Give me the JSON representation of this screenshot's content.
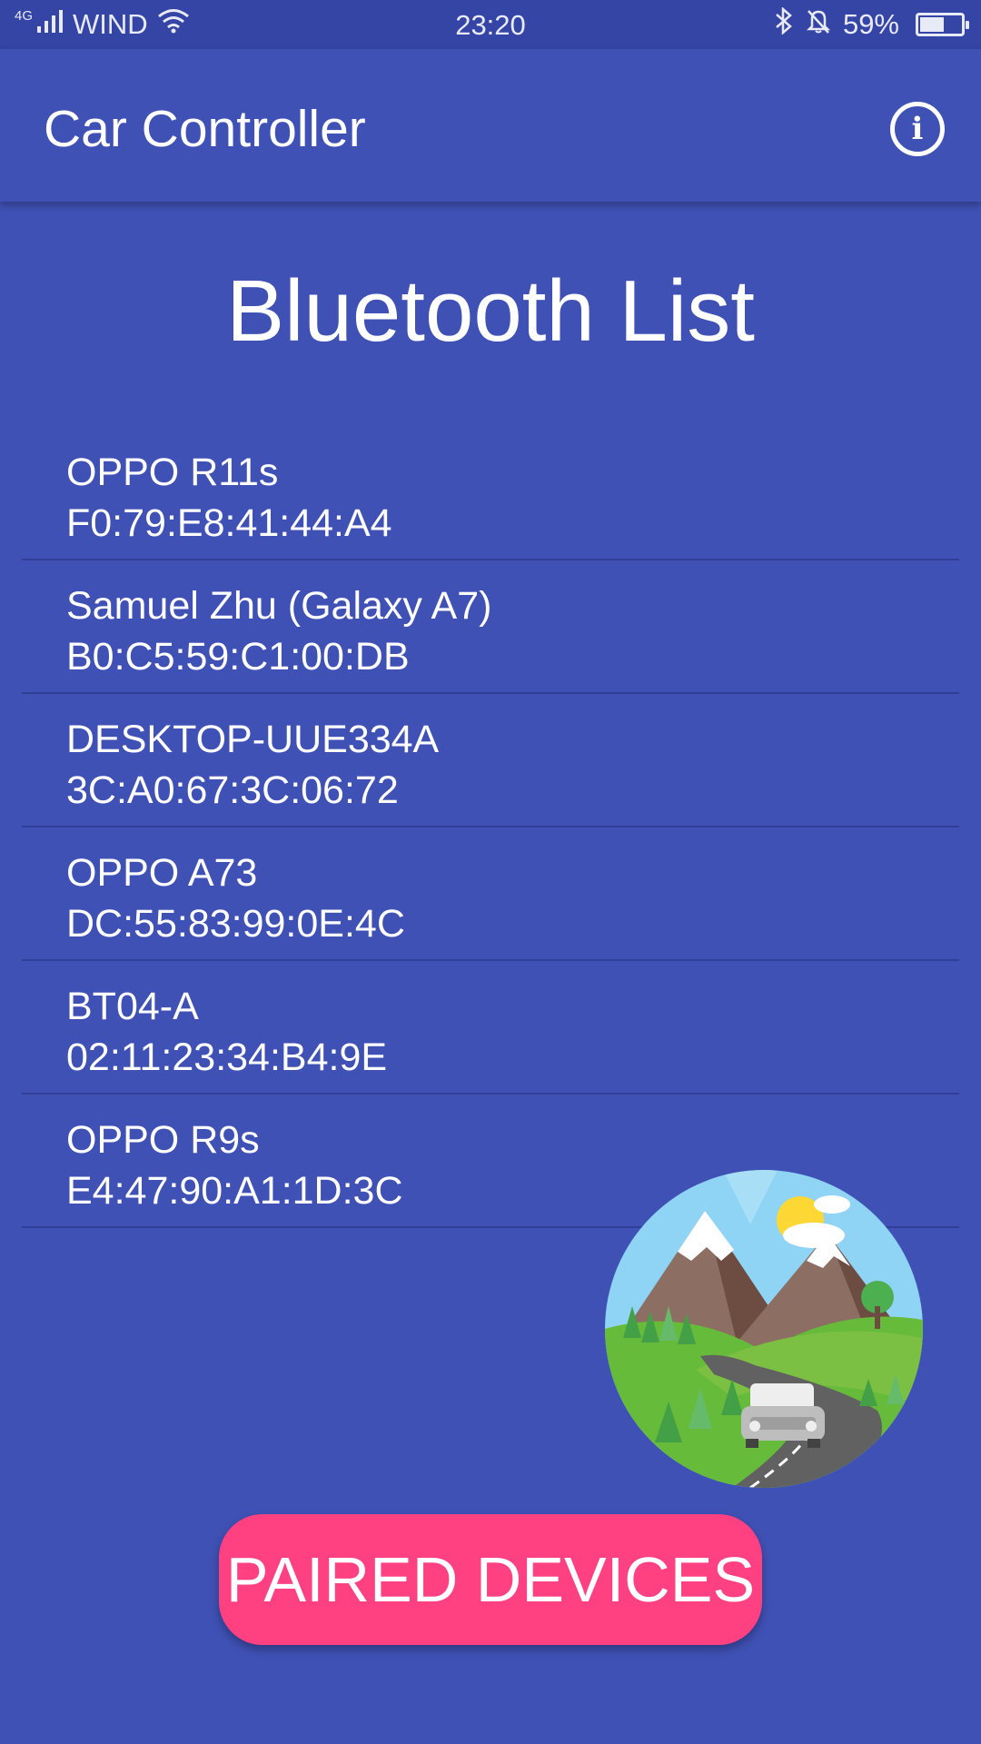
{
  "status_bar": {
    "network_type": "4G",
    "carrier": "WIND",
    "time": "23:20",
    "battery_percent": "59%",
    "battery_level": 0.59,
    "icons": [
      "signal-icon",
      "wifi-icon",
      "bluetooth-icon",
      "mute-bell-icon",
      "battery-icon"
    ]
  },
  "app_bar": {
    "title": "Car Controller",
    "info_icon": "info-icon"
  },
  "main": {
    "title": "Bluetooth List",
    "devices": [
      {
        "name": "OPPO R11s",
        "mac": "F0:79:E8:41:44:A4"
      },
      {
        "name": "Samuel Zhu (Galaxy A7)",
        "mac": "B0:C5:59:C1:00:DB"
      },
      {
        "name": "DESKTOP-UUE334A",
        "mac": "3C:A0:67:3C:06:72"
      },
      {
        "name": "OPPO A73",
        "mac": "DC:55:83:99:0E:4C"
      },
      {
        "name": "BT04-A",
        "mac": "02:11:23:34:B4:9E"
      },
      {
        "name": "OPPO R9s",
        "mac": "E4:47:90:A1:1D:3C"
      }
    ],
    "button_label": "PAIRED DEVICES"
  },
  "colors": {
    "primary": "#3f51b5",
    "status_bar": "#3545a6",
    "accent": "#ff4081"
  }
}
